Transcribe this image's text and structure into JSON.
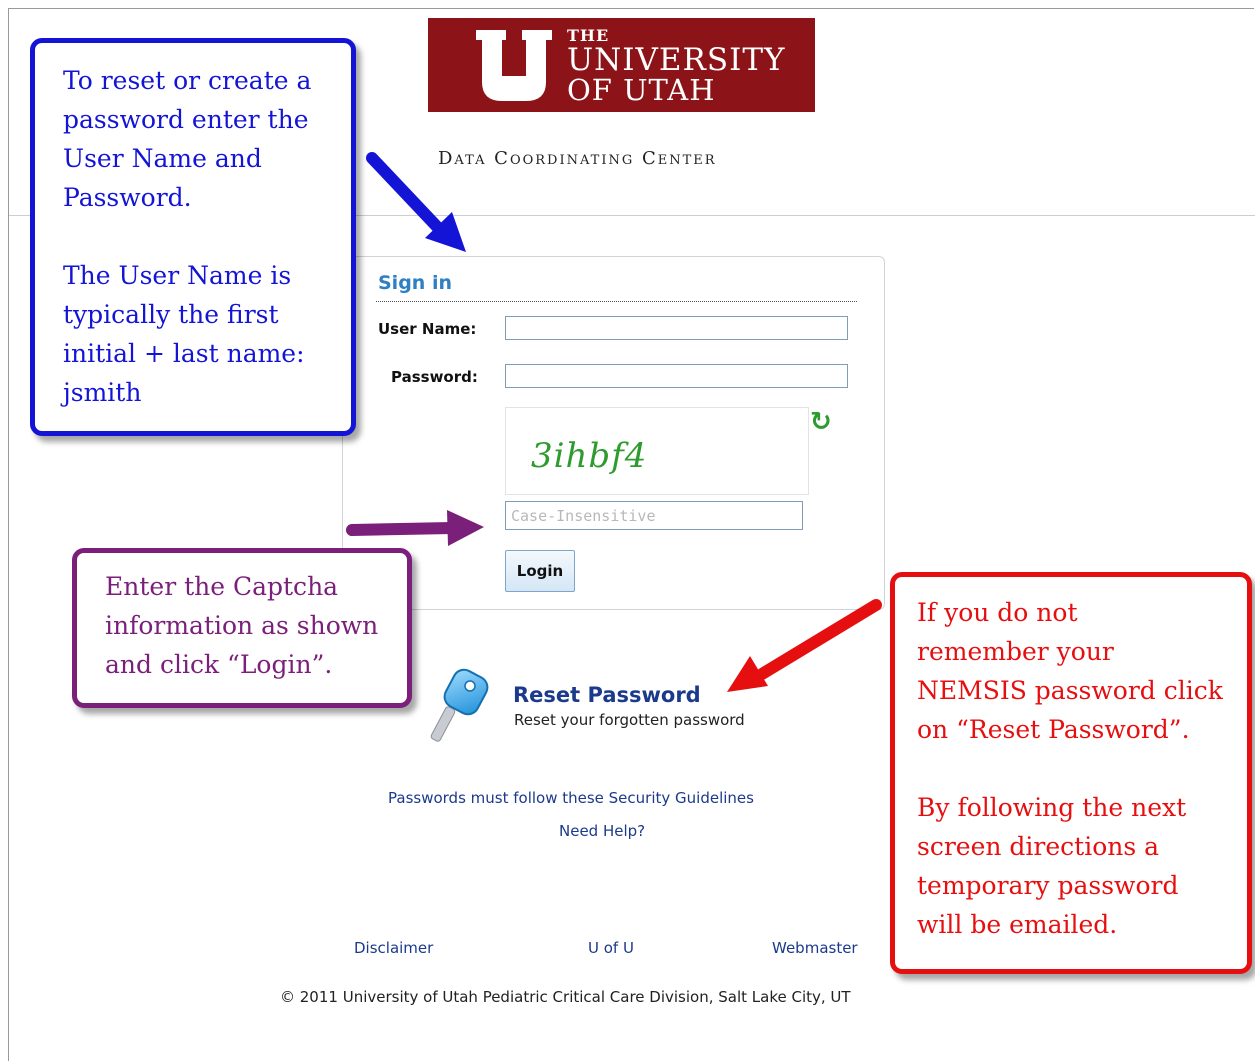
{
  "logo": {
    "the": "THE",
    "university": "UNIVERSITY",
    "of_utah": "OF UTAH"
  },
  "tagline": "Data Coordinating Center",
  "signin": {
    "title": "Sign in",
    "username_label": "User Name:",
    "password_label": "Password:",
    "captcha_text": "3ihbf4",
    "captcha_placeholder": "Case-Insensitive",
    "login_label": "Login"
  },
  "reset": {
    "title": "Reset Password",
    "subtitle": "Reset your forgotten password"
  },
  "links": {
    "guidelines": "Passwords must follow these Security Guidelines",
    "help": "Need Help?",
    "disclaimer": "Disclaimer",
    "uofu": "U of U",
    "webmaster": "Webmaster"
  },
  "footer": {
    "copyright": "© 2011 University of Utah Pediatric Critical Care Division, Salt Lake City, UT"
  },
  "callouts": {
    "blue": {
      "lines": [
        "To reset or create a",
        "password enter the",
        "User Name and",
        "Password."
      ],
      "lines2": [
        "The User Name is",
        "typically the first",
        "initial + last name:",
        "jsmith"
      ]
    },
    "purple": {
      "lines": [
        "Enter the Captcha",
        "information as shown",
        "and click “Login”."
      ]
    },
    "red": {
      "lines": [
        "If you do not",
        "remember your",
        "NEMSIS password click",
        "on “Reset Password”."
      ],
      "lines2": [
        "By following the next",
        "screen directions a",
        "temporary password",
        "will be emailed."
      ]
    }
  },
  "colors": {
    "logo_red": "#8c1418",
    "signin_blue": "#2f7fc4",
    "link_blue": "#1b3a8c",
    "captcha_green": "#2e9b2e",
    "callout_blue": "#1414d6",
    "callout_purple": "#7a1f7a",
    "callout_red": "#e60f0f"
  },
  "icons": {
    "refresh": "refresh-icon",
    "key": "key-icon",
    "logo_u": "block-u-logo-icon"
  }
}
